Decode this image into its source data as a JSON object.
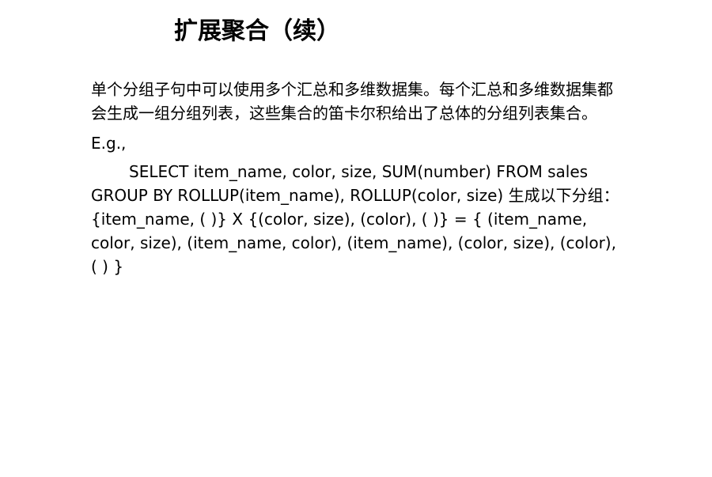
{
  "slide": {
    "title": "扩展聚合（续）",
    "paragraph": "单个分组子句中可以使用多个汇总和多维数据集。每个汇总和多维数据集都会生成一组分组列表，这些集合的笛卡尔积给出了总体的分组列表集合。",
    "eg_label": "E.g.,",
    "example": "SELECT item_name, color, size, SUM(number) FROM sales GROUP BY ROLLUP(item_name), ROLLUP(color, size) 生成以下分组：{item_name, ( )} X {(color, size), (color), ( )} = { (item_name, color, size), (item_name, color), (item_name), (color, size), (color), ( ) }"
  }
}
